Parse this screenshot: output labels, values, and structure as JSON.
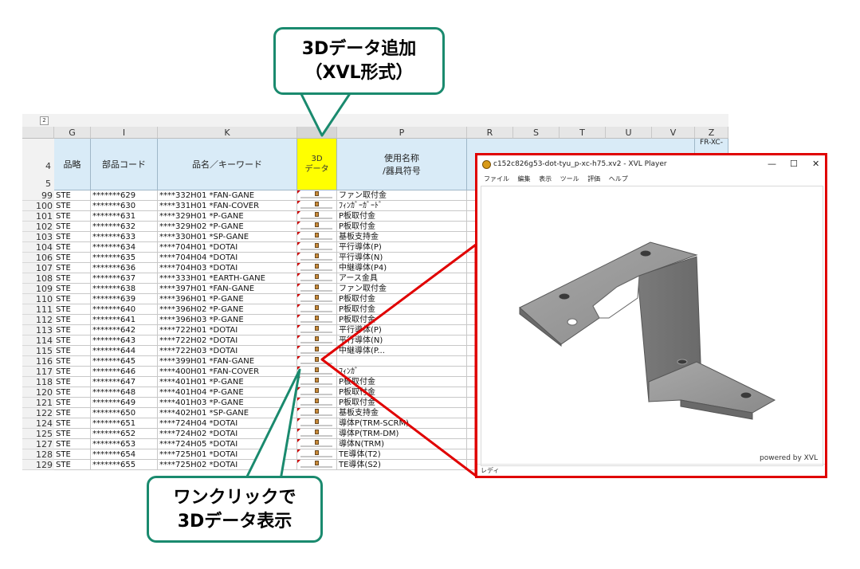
{
  "callouts": {
    "top_line1": "3Dデータ追加",
    "top_line2": "（XVL形式）",
    "bottom_line1": "ワンクリックで",
    "bottom_line2": "3Dデータ表示"
  },
  "sheet": {
    "group_levels": [
      "2",
      "2"
    ],
    "col_letters": [
      "G",
      "I",
      "K",
      "",
      "P",
      "R",
      "S",
      "T",
      "U",
      "V",
      "Z"
    ],
    "header_row_numbers": [
      "4",
      "5"
    ],
    "band": {
      "col_g": "品略",
      "col_i": "部品コード",
      "col_k": "品名／キーワード",
      "col_3d_line1": "3D",
      "col_3d_line2": "データ",
      "col_p_line1": "使用名称",
      "col_p_line2": "/器具符号",
      "col_z": "FR-XC-"
    },
    "rows": [
      {
        "n": "99",
        "g": "STE",
        "i": "*******629",
        "k": "****332H01 *FAN-GANE",
        "p": "ファン取付金"
      },
      {
        "n": "100",
        "g": "STE",
        "i": "*******630",
        "k": "****331H01 *FAN-COVER",
        "p": "ﾌｨﾝｶﾞｰｶﾞｰﾄﾞ"
      },
      {
        "n": "101",
        "g": "STE",
        "i": "*******631",
        "k": "****329H01 *P-GANE",
        "p": "P板取付金"
      },
      {
        "n": "102",
        "g": "STE",
        "i": "*******632",
        "k": "****329H02 *P-GANE",
        "p": "P板取付金"
      },
      {
        "n": "103",
        "g": "STE",
        "i": "*******633",
        "k": "****330H01 *SP-GANE",
        "p": "基板支持金"
      },
      {
        "n": "104",
        "g": "STE",
        "i": "*******634",
        "k": "****704H01 *DOTAI",
        "p": "平行導体(P)"
      },
      {
        "n": "106",
        "g": "STE",
        "i": "*******635",
        "k": "****704H04 *DOTAI",
        "p": "平行導体(N)"
      },
      {
        "n": "107",
        "g": "STE",
        "i": "*******636",
        "k": "****704H03 *DOTAI",
        "p": "中継導体(P4)"
      },
      {
        "n": "108",
        "g": "STE",
        "i": "*******637",
        "k": "****333H01 *EARTH-GANE",
        "p": "アース金具"
      },
      {
        "n": "109",
        "g": "STE",
        "i": "*******638",
        "k": "****397H01 *FAN-GANE",
        "p": "ファン取付金"
      },
      {
        "n": "110",
        "g": "STE",
        "i": "*******639",
        "k": "****396H01 *P-GANE",
        "p": "P板取付金"
      },
      {
        "n": "111",
        "g": "STE",
        "i": "*******640",
        "k": "****396H02 *P-GANE",
        "p": "P板取付金"
      },
      {
        "n": "112",
        "g": "STE",
        "i": "*******641",
        "k": "****396H03 *P-GANE",
        "p": "P板取付金"
      },
      {
        "n": "113",
        "g": "STE",
        "i": "*******642",
        "k": "****722H01 *DOTAI",
        "p": "平行導体(P)"
      },
      {
        "n": "114",
        "g": "STE",
        "i": "*******643",
        "k": "****722H02 *DOTAI",
        "p": "平行導体(N)"
      },
      {
        "n": "115",
        "g": "STE",
        "i": "*******644",
        "k": "****722H03 *DOTAI",
        "p": "中継導体(P..."
      },
      {
        "n": "116",
        "g": "STE",
        "i": "*******645",
        "k": "****399H01 *FAN-GANE",
        "p": ""
      },
      {
        "n": "117",
        "g": "STE",
        "i": "*******646",
        "k": "****400H01 *FAN-COVER",
        "p": "ﾌｨﾝｶﾞ"
      },
      {
        "n": "118",
        "g": "STE",
        "i": "*******647",
        "k": "****401H01 *P-GANE",
        "p": "P板取付金"
      },
      {
        "n": "120",
        "g": "STE",
        "i": "*******648",
        "k": "****401H04 *P-GANE",
        "p": "P板取付金"
      },
      {
        "n": "121",
        "g": "STE",
        "i": "*******649",
        "k": "****401H03 *P-GANE",
        "p": "P板取付金"
      },
      {
        "n": "122",
        "g": "STE",
        "i": "*******650",
        "k": "****402H01 *SP-GANE",
        "p": "基板支持金"
      },
      {
        "n": "124",
        "g": "STE",
        "i": "*******651",
        "k": "****724H04 *DOTAI",
        "p": "導体P(TRM-SCRM)"
      },
      {
        "n": "125",
        "g": "STE",
        "i": "*******652",
        "k": "****724H02 *DOTAI",
        "p": "導体P(TRM-DM)"
      },
      {
        "n": "127",
        "g": "STE",
        "i": "*******653",
        "k": "****724H05 *DOTAI",
        "p": "導体N(TRM)"
      },
      {
        "n": "128",
        "g": "STE",
        "i": "*******654",
        "k": "****725H01 *DOTAI",
        "p": "TE導体(T2)"
      },
      {
        "n": "129",
        "g": "STE",
        "i": "*******655",
        "k": "****725H02 *DOTAI",
        "p": "TE導体(S2)"
      }
    ]
  },
  "viewer": {
    "title": "c152c826g53-dot-tyu_p-xc-h75.xv2 - XVL Player",
    "menu": [
      "ファイル",
      "編集",
      "表示",
      "ツール",
      "評価",
      "ヘルプ"
    ],
    "minimize_glyph": "—",
    "maximize_glyph": "☐",
    "close_glyph": "✕",
    "watermark": "powered by XVL",
    "status": "レディ"
  },
  "colors": {
    "callout_border": "#1a8a6e",
    "viewer_border": "#e00000",
    "header_band": "#d9ebf7",
    "highlight_yellow": "#ffff00"
  }
}
